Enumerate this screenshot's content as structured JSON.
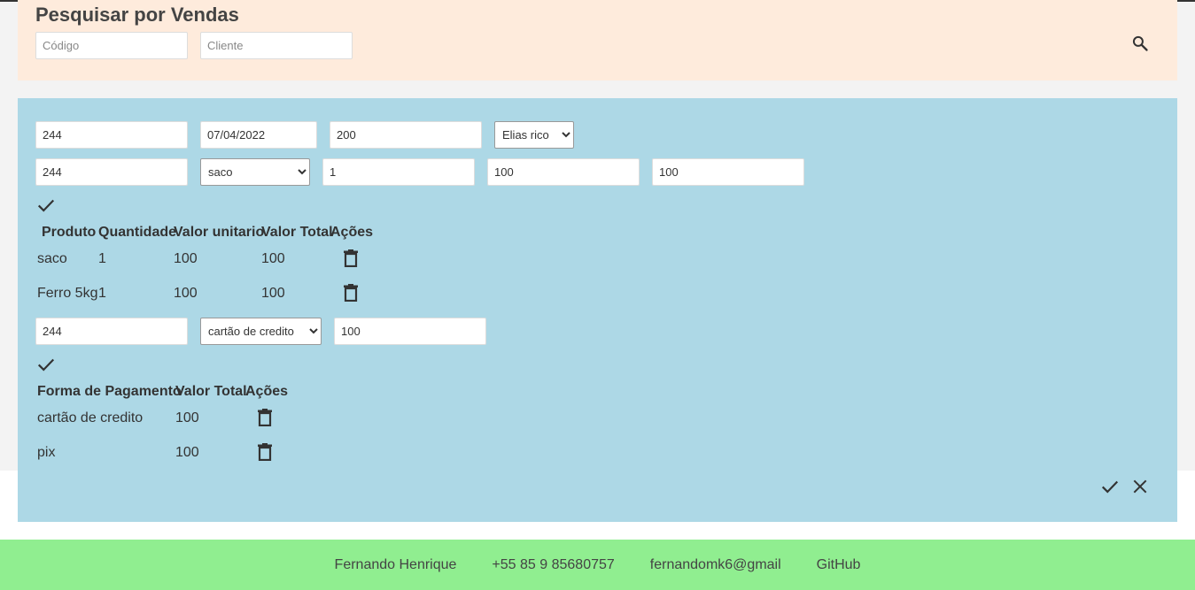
{
  "search": {
    "title": "Pesquisar por Vendas",
    "code_placeholder": "Código",
    "client_placeholder": "Cliente",
    "search_icon": "search-icon"
  },
  "sale": {
    "code": "244",
    "date": "07/04/2022",
    "total": "200",
    "client_selected": "Elias rico",
    "product_form": {
      "code": "244",
      "product_selected": "saco",
      "quantity": "1",
      "unit_value": "100",
      "total_value": "100"
    },
    "products_table": {
      "headers": [
        "Produto",
        "Quantidade",
        "Valor unitario",
        "Valor Total",
        "Ações"
      ],
      "rows": [
        {
          "product": "saco",
          "quantity": "1",
          "unit": "100",
          "total": "100"
        },
        {
          "product": "Ferro 5kg",
          "quantity": "1",
          "unit": "100",
          "total": "100"
        }
      ]
    },
    "payment_form": {
      "code": "244",
      "method_selected": "cartão de credito",
      "value": "100"
    },
    "payments_table": {
      "headers": [
        "Forma de Pagamento",
        "Valor Total",
        "Ações"
      ],
      "rows": [
        {
          "method": "cartão de credito",
          "total": "100"
        },
        {
          "method": "pix",
          "total": "100"
        }
      ]
    }
  },
  "footer": {
    "name": "Fernando Henrique",
    "phone": "+55 85 9 85680757",
    "email": "fernandomk6@gmail",
    "github": "GitHub"
  },
  "colors": {
    "search_panel": "#feebdc",
    "sale_panel": "#add8e6",
    "footer": "#90ee90"
  }
}
